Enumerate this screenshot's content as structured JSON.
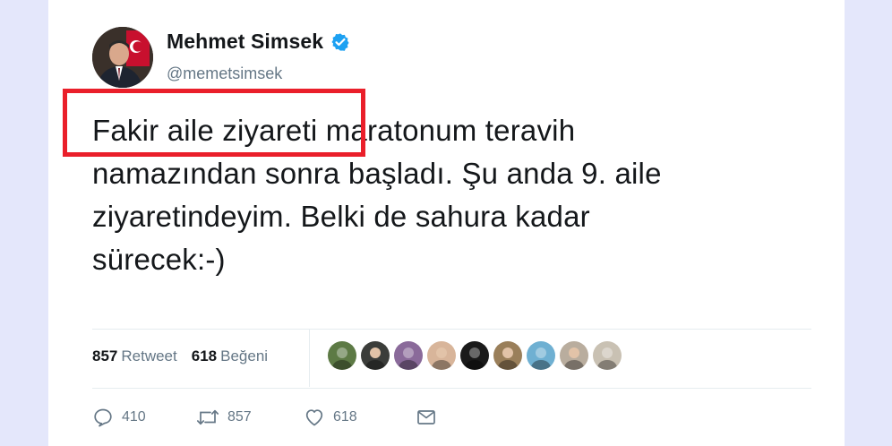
{
  "author": {
    "name": "Mehmet Simsek",
    "handle": "@memetsimsek",
    "verified": true
  },
  "tweet": {
    "text_lines": [
      "Fakir aile ziyareti maratonum teravih",
      "namazından sonra başladı. Şu anda 9. aile",
      "ziyaretindeyim. Belki de sahura kadar",
      "sürecek:-)"
    ],
    "highlighted_phrase": "Fakir aile ziyareti"
  },
  "stats": {
    "retweets_count": "857",
    "retweets_label": "Retweet",
    "likes_count": "618",
    "likes_label": "Beğeni"
  },
  "likers": {
    "count_shown": 9,
    "colors": [
      "#5d7a45",
      "#3b3d3a",
      "#8a6a9a",
      "#d8b59a",
      "#1a1a1a",
      "#9a7f5a",
      "#6fb0d2",
      "#b9ad9e",
      "#c9c1b3"
    ]
  },
  "actions": {
    "reply_count": "410",
    "retweet_count": "857",
    "like_count": "618"
  },
  "colors": {
    "highlight": "#ea1f2a",
    "verified": "#1da1f2",
    "secondary_text": "#657786"
  }
}
